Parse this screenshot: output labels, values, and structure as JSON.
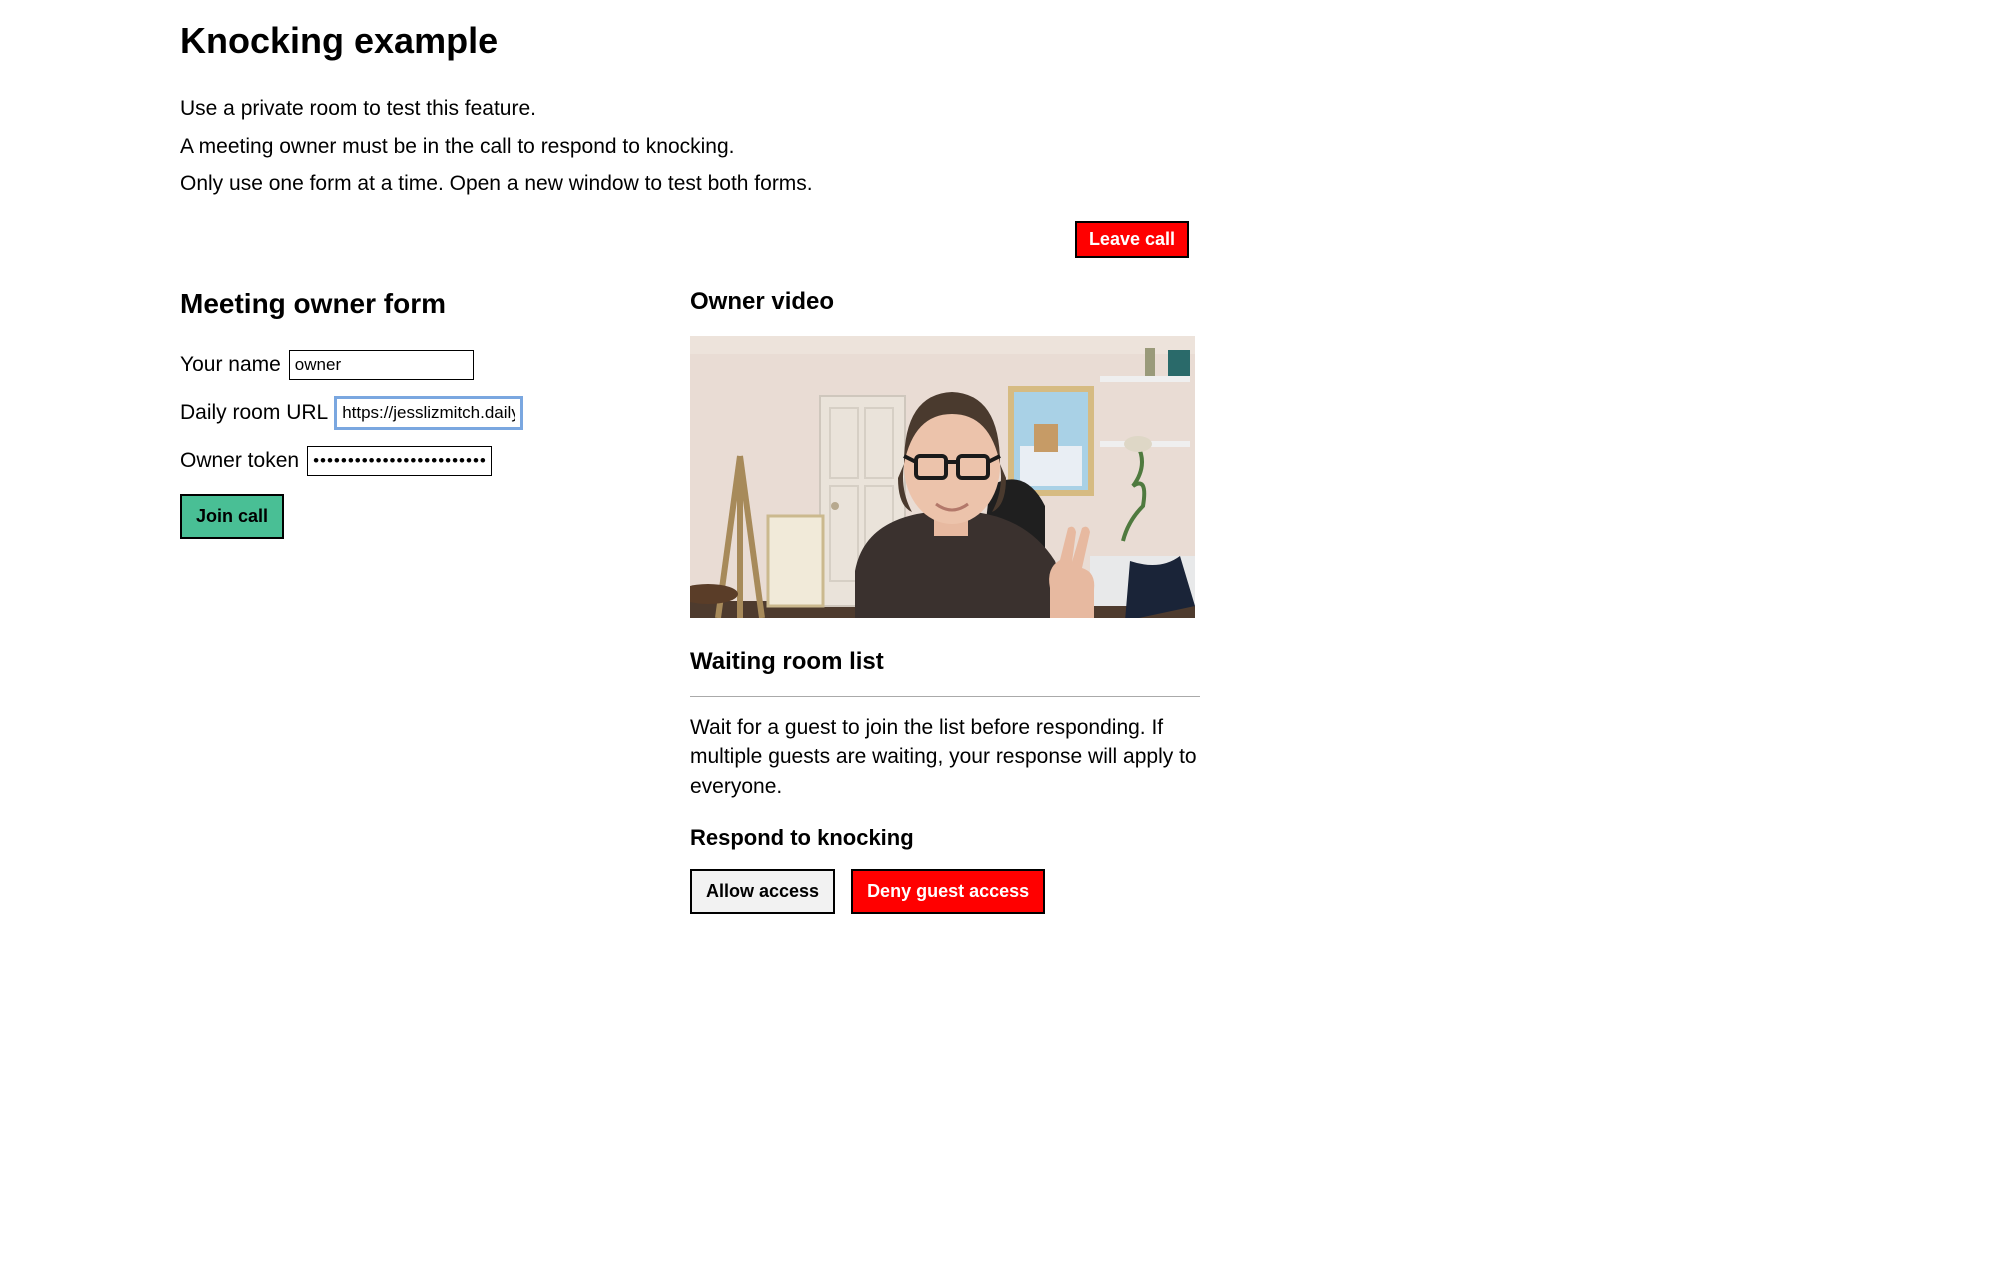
{
  "page": {
    "title": "Knocking example",
    "intro_lines": [
      "Use a private room to test this feature.",
      "A meeting owner must be in the call to respond to knocking.",
      "Only use one form at a time. Open a new window to test both forms."
    ]
  },
  "buttons": {
    "leave_call": "Leave call",
    "join_call": "Join call",
    "allow_access": "Allow access",
    "deny_access": "Deny guest access"
  },
  "owner_form": {
    "heading": "Meeting owner form",
    "name_label": "Your name",
    "name_value": "owner",
    "url_label": "Daily room URL",
    "url_value": "https://jesslizmitch.daily",
    "token_label": "Owner token",
    "token_value": "••••••••••••••••••••••••••"
  },
  "video": {
    "heading": "Owner video"
  },
  "waiting": {
    "heading": "Waiting room list",
    "help_text": "Wait for a guest to join the list before responding. If multiple guests are waiting, your response will apply to everyone.",
    "respond_heading": "Respond to knocking"
  }
}
